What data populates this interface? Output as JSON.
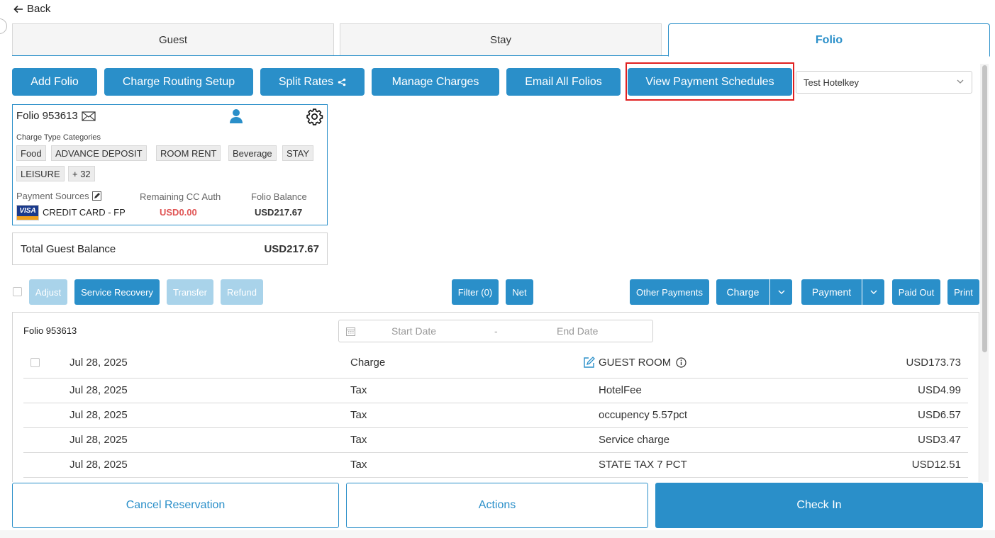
{
  "nav": {
    "back_label": "Back"
  },
  "tabs": [
    {
      "label": "Guest"
    },
    {
      "label": "Stay"
    },
    {
      "label": "Folio"
    }
  ],
  "toolbar": {
    "add_folio": "Add Folio",
    "charge_routing": "Charge Routing Setup",
    "split_rates": "Split Rates",
    "manage_charges": "Manage Charges",
    "email_all": "Email All Folios",
    "view_payment_schedules": "View Payment Schedules",
    "property_select": "Test Hotelkey"
  },
  "folio_card": {
    "title": "Folio 953613",
    "categories_label": "Charge Type Categories",
    "categories": [
      "Food",
      "ADVANCE DEPOSIT",
      "ROOM RENT",
      "Beverage",
      "STAY",
      "LEISURE",
      "+ 32"
    ],
    "payment_sources_label": "Payment Sources",
    "card_brand": "VISA",
    "payment_source": "CREDIT CARD - FP",
    "remaining_label": "Remaining CC Auth",
    "remaining_value": "USD0.00",
    "balance_label": "Folio Balance",
    "balance_value": "USD217.67"
  },
  "total": {
    "label": "Total Guest Balance",
    "value": "USD217.67"
  },
  "actions": {
    "adjust": "Adjust",
    "service_recovery": "Service Recovery",
    "transfer": "Transfer",
    "refund": "Refund",
    "filter": "Filter (0)",
    "net": "Net",
    "other_payments": "Other Payments",
    "charge": "Charge",
    "payment": "Payment",
    "paid_out": "Paid Out",
    "print": "Print"
  },
  "list": {
    "folio_label": "Folio 953613",
    "start_placeholder": "Start Date",
    "separator": "-",
    "end_placeholder": "End Date",
    "rows": [
      {
        "date": "Jul 28, 2025",
        "type": "Charge",
        "description": "GUEST ROOM",
        "amount": "USD173.73"
      },
      {
        "date": "Jul 28, 2025",
        "type": "Tax",
        "description": "HotelFee",
        "amount": "USD4.99"
      },
      {
        "date": "Jul 28, 2025",
        "type": "Tax",
        "description": "occupency 5.57pct",
        "amount": "USD6.57"
      },
      {
        "date": "Jul 28, 2025",
        "type": "Tax",
        "description": "Service charge",
        "amount": "USD3.47"
      },
      {
        "date": "Jul 28, 2025",
        "type": "Tax",
        "description": "STATE TAX 7 PCT",
        "amount": "USD12.51"
      }
    ]
  },
  "bottom": {
    "cancel": "Cancel Reservation",
    "actions": "Actions",
    "check_in": "Check In"
  },
  "colors": {
    "accent": "#2a8fc9",
    "highlight": "#e02020",
    "negative": "#e05555"
  }
}
